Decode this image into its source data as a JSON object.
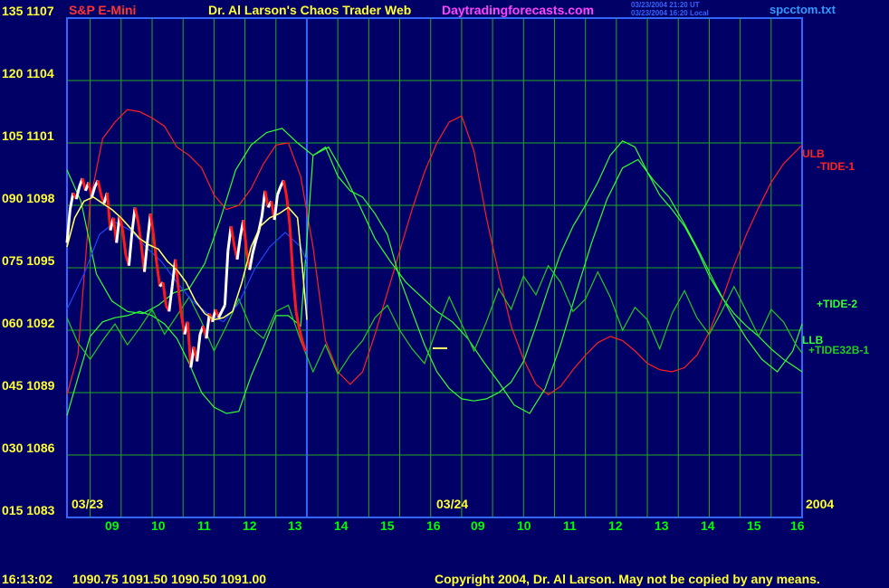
{
  "header": {
    "symbol": "S&P E-Mini",
    "title": "Dr. Al Larson's Chaos Trader Web",
    "website": "Daytradingforecasts.com",
    "timestamp_ut": "03/23/2004 21:20 UT",
    "timestamp_local": "03/23/2004 16:20 Local",
    "filename": "spcctom.txt"
  },
  "footer": {
    "time": "16:13:02",
    "ohlc": "1090.75 1091.50 1090.50 1091.00",
    "copyright": "Copyright 2004, Dr. Al Larson. May not be copied by any means."
  },
  "chart_data": {
    "type": "line",
    "title": "S&P E-Mini",
    "xlabel": "",
    "ylabel": "",
    "grid": true,
    "legend_position": "right",
    "ylim": [
      1083,
      1107
    ],
    "y_ticks": [
      "015 1083",
      "030 1086",
      "045 1089",
      "060 1092",
      "075 1095",
      "090 1098",
      "105 1101",
      "120 1104",
      "135 1107"
    ],
    "x_ticks": [
      "09",
      "10",
      "11",
      "12",
      "13",
      "14",
      "15",
      "16",
      "09",
      "10",
      "11",
      "12",
      "13",
      "14",
      "15",
      "16"
    ],
    "date_labels": [
      "03/23",
      "03/24",
      "2004"
    ],
    "xlim": [
      8.25,
      32.0
    ],
    "day_boundary_x": 16.0,
    "price_ohlc_last": {
      "open": 1090.75,
      "high": 1091.5,
      "low": 1090.5,
      "close": 1091.0
    },
    "series": [
      {
        "name": "ULB",
        "label": "ULB",
        "color": "#ff2020",
        "x": [
          8.25,
          8.6,
          9.0,
          9.4,
          9.8,
          10.2,
          10.6,
          11.0,
          11.4,
          11.8,
          12.2,
          12.6,
          13.0,
          13.4,
          13.8,
          14.2,
          14.6,
          15.0,
          15.4,
          15.8,
          16.2,
          16.6,
          17.0,
          17.4,
          17.8,
          18.2,
          18.6,
          19.0,
          19.4,
          19.8,
          20.2,
          20.6,
          21.0,
          21.4,
          21.8,
          22.2,
          22.6,
          23.0,
          23.4,
          23.8,
          24.2,
          24.6,
          25.0,
          25.4,
          25.8,
          26.2,
          26.6,
          27.0,
          27.4,
          27.8,
          28.2,
          28.6,
          29.0,
          29.4,
          29.8,
          30.2,
          30.6,
          31.0,
          31.4,
          31.8,
          32.0
        ],
        "y": [
          1088.9,
          1090.8,
          1098.2,
          1101.2,
          1102.0,
          1102.6,
          1102.5,
          1102.2,
          1101.8,
          1100.8,
          1100.4,
          1099.8,
          1098.5,
          1097.8,
          1098.0,
          1098.8,
          1100.0,
          1100.9,
          1101.0,
          1099.4,
          1096.0,
          1091.5,
          1090.0,
          1089.4,
          1090.0,
          1091.8,
          1093.8,
          1095.8,
          1097.8,
          1099.6,
          1101.0,
          1102.0,
          1102.3,
          1100.6,
          1097.4,
          1094.7,
          1092.2,
          1090.6,
          1089.4,
          1088.9,
          1089.3,
          1090.1,
          1090.8,
          1091.4,
          1091.7,
          1091.5,
          1091.0,
          1090.4,
          1090.1,
          1090.0,
          1090.2,
          1090.8,
          1091.9,
          1093.4,
          1095.1,
          1096.6,
          1097.9,
          1099.1,
          1100.0,
          1100.6,
          1100.9
        ]
      },
      {
        "name": "LLB",
        "label": "LLB",
        "color": "#33ff33",
        "x": [
          8.25,
          8.6,
          9.0,
          9.4,
          9.8,
          10.2,
          10.6,
          11.0,
          11.4,
          11.8,
          12.2,
          12.6,
          13.0,
          13.4,
          13.8,
          14.2,
          14.6,
          15.0,
          15.4,
          15.8,
          16.2,
          16.6,
          17.0,
          17.4,
          17.8,
          18.2,
          18.6,
          19.0,
          19.4,
          19.8,
          20.2,
          20.6,
          21.0,
          21.4,
          21.8,
          22.2,
          22.6,
          23.0,
          23.4,
          23.8,
          24.2,
          24.6,
          25.0,
          25.4,
          25.8,
          26.2,
          26.6,
          27.0,
          27.4,
          27.8,
          28.2,
          28.6,
          29.0,
          29.4,
          29.8,
          30.2,
          30.6,
          31.0,
          31.4,
          31.8,
          32.0
        ],
        "y": [
          1087.9,
          1089.7,
          1091.7,
          1092.4,
          1092.6,
          1092.7,
          1092.9,
          1092.7,
          1092.3,
          1091.6,
          1090.4,
          1089.0,
          1088.3,
          1088.0,
          1088.1,
          1089.8,
          1091.2,
          1092.7,
          1092.7,
          1092.2,
          1100.4,
          1100.8,
          1099.4,
          1098.7,
          1098.4,
          1097.6,
          1096.6,
          1094.5,
          1092.9,
          1091.3,
          1090.0,
          1089.2,
          1088.7,
          1088.6,
          1088.7,
          1089.0,
          1089.5,
          1090.5,
          1092.2,
          1094.0,
          1095.7,
          1097.0,
          1098.0,
          1099.1,
          1100.4,
          1101.1,
          1100.8,
          1099.6,
          1098.5,
          1097.8,
          1097.0,
          1095.9,
          1094.6,
          1093.6,
          1092.8,
          1092.2,
          1091.7,
          1091.1,
          1090.6,
          1090.2,
          1090.0
        ]
      },
      {
        "name": "-TIDE-1",
        "label": "-TIDE-1",
        "color": "#ff2020",
        "x": [
          8.25,
          8.6,
          9.0,
          9.4,
          9.8,
          10.2,
          10.6,
          11.0,
          11.4,
          11.8,
          12.2,
          12.6,
          13.0,
          13.4,
          13.8,
          14.2,
          14.6,
          15.0,
          15.4,
          15.8,
          16.2,
          16.6,
          17.0,
          17.4,
          17.8,
          18.2,
          18.6,
          19.0,
          19.4,
          19.8,
          20.2,
          20.6,
          21.0,
          21.4,
          21.8,
          22.2,
          22.6,
          23.0,
          23.4,
          23.8,
          24.2,
          24.6,
          25.0,
          25.4,
          25.8,
          26.2,
          26.6,
          27.0,
          27.4,
          27.8,
          28.2,
          28.6,
          29.0,
          29.4,
          29.8,
          30.2,
          30.6,
          31.0,
          31.4,
          31.8,
          32.0
        ],
        "y": [
          1088.9,
          1090.8,
          1098.2,
          1101.2,
          1102.0,
          1102.6,
          1102.5,
          1102.2,
          1101.8,
          1100.8,
          1100.4,
          1099.8,
          1098.5,
          1097.8,
          1098.0,
          1098.8,
          1100.0,
          1100.9,
          1101.0,
          1099.4,
          1096.0,
          1091.5,
          1090.0,
          1089.4,
          1090.0,
          1091.8,
          1093.8,
          1095.8,
          1097.8,
          1099.6,
          1101.0,
          1102.0,
          1102.3,
          1100.6,
          1097.4,
          1094.7,
          1092.2,
          1090.6,
          1089.4,
          1088.9,
          1089.3,
          1090.1,
          1090.8,
          1091.4,
          1091.7,
          1091.5,
          1091.0,
          1090.4,
          1090.1,
          1090.0,
          1090.2,
          1090.8,
          1091.9,
          1093.4,
          1095.1,
          1096.6,
          1097.9,
          1099.1,
          1100.0,
          1100.6,
          1100.9
        ]
      },
      {
        "name": "+TIDE-2",
        "label": "+TIDE-2",
        "color": "#33ff33",
        "x": [
          8.25,
          8.7,
          9.2,
          9.7,
          10.2,
          10.7,
          11.2,
          11.7,
          12.2,
          12.7,
          13.2,
          13.7,
          14.2,
          14.7,
          15.2,
          15.7,
          16.2,
          16.7,
          17.2,
          17.7,
          18.2,
          18.7,
          19.2,
          19.7,
          20.2,
          20.7,
          21.2,
          21.7,
          22.2,
          22.7,
          23.2,
          23.7,
          24.2,
          24.7,
          25.2,
          25.7,
          26.2,
          26.7,
          27.2,
          27.7,
          28.2,
          28.7,
          29.2,
          29.7,
          30.2,
          30.7,
          31.2,
          31.7,
          32.0
        ],
        "y": [
          1099.7,
          1098.2,
          1094.7,
          1093.4,
          1092.9,
          1092.8,
          1093.2,
          1093.8,
          1094.0,
          1095.2,
          1097.3,
          1099.7,
          1100.9,
          1101.5,
          1101.7,
          1101.0,
          1100.4,
          1100.8,
          1099.5,
          1098.0,
          1096.4,
          1095.3,
          1094.3,
          1093.6,
          1092.9,
          1092.4,
          1091.6,
          1090.5,
          1089.5,
          1088.4,
          1088.0,
          1089.2,
          1091.3,
          1093.8,
          1096.2,
          1098.3,
          1099.8,
          1100.2,
          1099.2,
          1098.4,
          1097.1,
          1095.7,
          1094.2,
          1092.8,
          1091.6,
          1090.6,
          1090.0,
          1091.0,
          1092.3
        ]
      },
      {
        "name": "+TIDE32B-1",
        "label": "+TIDE32B-1",
        "color": "#22cc22",
        "x": [
          8.25,
          8.6,
          9.0,
          9.4,
          9.8,
          10.2,
          10.6,
          11.0,
          11.4,
          11.8,
          12.2,
          12.6,
          13.0,
          13.4,
          13.8,
          14.2,
          14.6,
          15.0,
          15.4,
          15.8,
          16.2,
          16.6,
          17.0,
          17.4,
          17.8,
          18.2,
          18.6,
          19.0,
          19.4,
          19.8,
          20.2,
          20.6,
          21.0,
          21.4,
          21.8,
          22.2,
          22.6,
          23.0,
          23.4,
          23.8,
          24.2,
          24.6,
          25.0,
          25.4,
          25.8,
          26.2,
          26.6,
          27.0,
          27.4,
          27.8,
          28.2,
          28.6,
          29.0,
          29.4,
          29.8,
          30.2,
          30.6,
          31.0,
          31.4,
          31.8,
          32.0
        ],
        "y": [
          1092.6,
          1091.4,
          1090.6,
          1091.5,
          1092.3,
          1091.3,
          1092.1,
          1093.0,
          1091.8,
          1092.7,
          1093.6,
          1092.4,
          1091.0,
          1092.2,
          1093.5,
          1092.1,
          1091.6,
          1092.9,
          1093.2,
          1091.5,
          1090.0,
          1091.3,
          1089.9,
          1090.8,
          1091.5,
          1092.6,
          1093.2,
          1092.0,
          1091.1,
          1090.4,
          1092.1,
          1093.6,
          1092.3,
          1091.0,
          1092.4,
          1094.0,
          1093.0,
          1094.6,
          1093.7,
          1095.1,
          1094.3,
          1092.9,
          1093.5,
          1094.8,
          1093.6,
          1092.0,
          1093.1,
          1092.5,
          1091.1,
          1092.8,
          1093.9,
          1092.6,
          1091.8,
          1092.9,
          1094.1,
          1092.9,
          1091.7,
          1093.0,
          1092.4,
          1091.3,
          1090.9
        ]
      },
      {
        "name": "blue-average",
        "color": "#2244ff",
        "x": [
          8.25,
          8.8,
          9.3,
          9.8,
          10.3,
          10.8,
          11.3,
          11.8,
          12.3,
          12.8,
          13.3,
          13.8,
          14.3,
          14.8,
          15.3,
          15.8,
          16.0
        ],
        "y": [
          1093.0,
          1094.7,
          1096.6,
          1097.2,
          1096.8,
          1096.0,
          1095.3,
          1094.3,
          1093.4,
          1092.8,
          1092.4,
          1093.3,
          1094.9,
          1096.0,
          1096.7,
          1096.0,
          1095.3
        ]
      },
      {
        "name": "price-short-ma",
        "color": "#ffff66",
        "x": [
          8.25,
          8.5,
          8.8,
          9.1,
          9.4,
          9.7,
          10.0,
          10.3,
          10.6,
          10.9,
          11.2,
          11.5,
          11.8,
          12.1,
          12.4,
          12.7,
          13.0,
          13.3,
          13.6,
          13.9,
          14.2,
          14.5,
          14.8,
          15.1,
          15.4,
          15.7,
          15.85,
          16.0
        ],
        "y": [
          1096.0,
          1097.4,
          1098.2,
          1098.4,
          1098.1,
          1097.8,
          1097.4,
          1096.9,
          1096.4,
          1096.1,
          1095.9,
          1095.3,
          1094.9,
          1094.3,
          1093.4,
          1092.8,
          1092.5,
          1092.6,
          1092.9,
          1094.3,
          1096.0,
          1097.0,
          1097.4,
          1097.6,
          1097.9,
          1097.4,
          1095.1,
          1092.5
        ]
      },
      {
        "name": "price-5min",
        "color_up": "#ffffff",
        "color_down": "#ff1a1a",
        "x": [
          8.25,
          8.35,
          8.45,
          8.55,
          8.65,
          8.75,
          8.85,
          8.95,
          9.05,
          9.15,
          9.25,
          9.35,
          9.45,
          9.55,
          9.65,
          9.75,
          9.85,
          9.95,
          10.05,
          10.15,
          10.25,
          10.35,
          10.45,
          10.55,
          10.65,
          10.75,
          10.85,
          10.95,
          11.05,
          11.15,
          11.25,
          11.35,
          11.45,
          11.55,
          11.65,
          11.75,
          11.85,
          11.95,
          12.05,
          12.15,
          12.25,
          12.35,
          12.45,
          12.55,
          12.65,
          12.75,
          12.85,
          12.95,
          13.05,
          13.15,
          13.25,
          13.35,
          13.45,
          13.55,
          13.65,
          13.75,
          13.85,
          13.95,
          14.05,
          14.15,
          14.25,
          14.35,
          14.45,
          14.55,
          14.65,
          14.75,
          14.85,
          14.95,
          15.05,
          15.15,
          15.25,
          15.35,
          15.45,
          15.55,
          15.65,
          15.75,
          15.85,
          15.95
        ],
        "y": [
          1096.2,
          1097.8,
          1098.6,
          1098.3,
          1098.9,
          1099.3,
          1098.7,
          1099.1,
          1098.4,
          1098.9,
          1099.2,
          1098.5,
          1098.1,
          1098.6,
          1096.8,
          1097.4,
          1096.2,
          1097.5,
          1096.8,
          1095.6,
          1095.1,
          1096.7,
          1097.9,
          1097.2,
          1096.1,
          1094.8,
          1096.3,
          1097.6,
          1096.5,
          1095.2,
          1094.1,
          1094.3,
          1093.2,
          1092.9,
          1094.1,
          1095.4,
          1094.0,
          1092.7,
          1091.8,
          1092.4,
          1090.2,
          1091.2,
          1090.5,
          1091.8,
          1092.2,
          1091.6,
          1092.8,
          1092.4,
          1093.0,
          1092.6,
          1092.9,
          1093.2,
          1095.8,
          1097.0,
          1096.1,
          1095.4,
          1096.5,
          1097.3,
          1095.8,
          1094.9,
          1095.7,
          1096.3,
          1096.8,
          1097.5,
          1098.7,
          1097.9,
          1098.2,
          1097.3,
          1098.5,
          1098.9,
          1099.2,
          1098.4,
          1097.0,
          1094.6,
          1092.9,
          1092.1,
          1091.5,
          1091.0
        ]
      }
    ]
  }
}
